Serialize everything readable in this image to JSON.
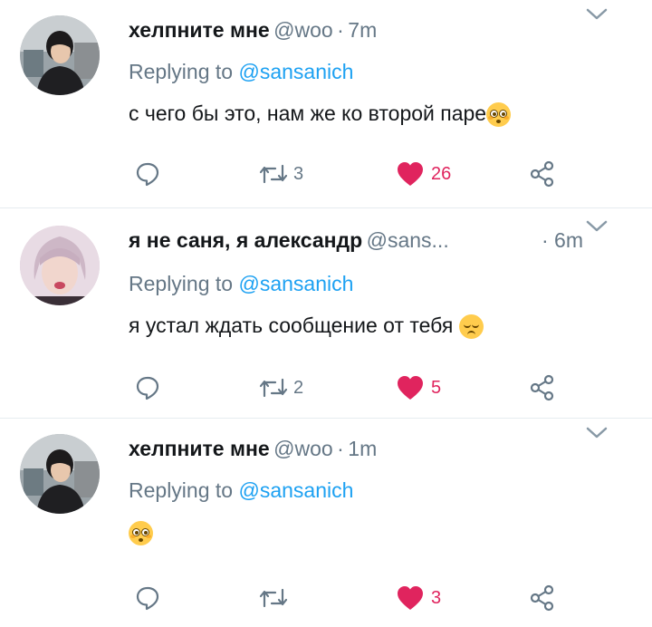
{
  "colors": {
    "accent": "#1da1f2",
    "like": "#e0245e",
    "muted": "#657786",
    "text": "#14171a"
  },
  "tweets": [
    {
      "name": "хелпните мне",
      "handle": "@woo",
      "separator": "·",
      "time": "7m",
      "replying_prefix": "Replying to",
      "replying_to": "@sansanich",
      "text": "с чего бы это, нам же ко второй паре",
      "emoji": "flushed-face-icon",
      "retweets": "3",
      "likes": "26",
      "liked": true
    },
    {
      "name": "я не саня, я александр",
      "handle": "@sans...",
      "separator": "·",
      "time": "6m",
      "replying_prefix": "Replying to",
      "replying_to": "@sansanich",
      "text": "я устал ждать сообщение от тебя",
      "emoji": "pensive-face-icon",
      "retweets": "2",
      "likes": "5",
      "liked": true
    },
    {
      "name": "хелпните мне",
      "handle": "@woo",
      "separator": "·",
      "time": "1m",
      "replying_prefix": "Replying to",
      "replying_to": "@sansanich",
      "text": "",
      "emoji": "flushed-face-icon",
      "retweets": "",
      "likes": "3",
      "liked": true
    }
  ]
}
